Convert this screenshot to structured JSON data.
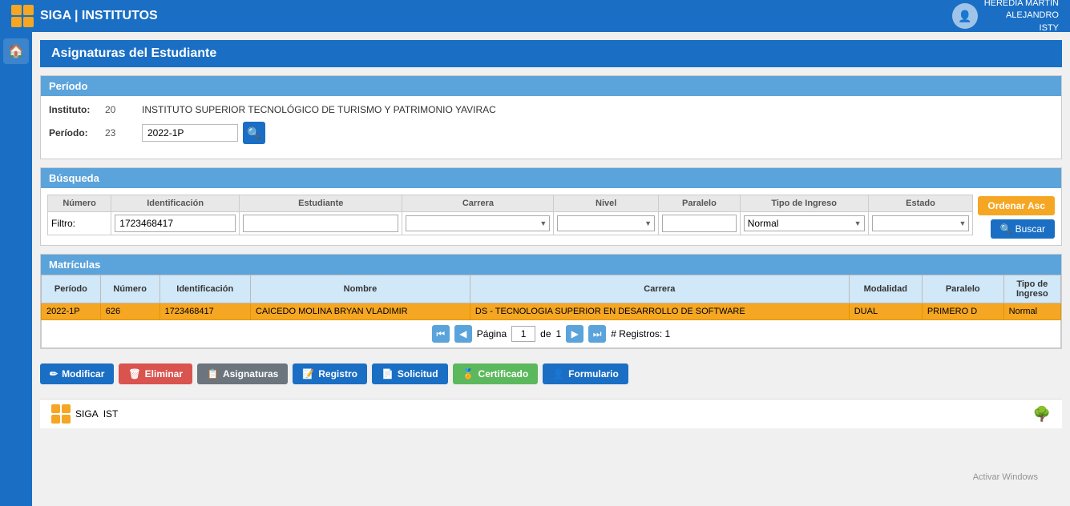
{
  "header": {
    "title": "SIGA | INSTITUTOS",
    "user": {
      "name": "HEREDIA MARTIN",
      "role": "ALEJANDRO",
      "org": "ISTY"
    }
  },
  "page": {
    "title": "Asignaturas del Estudiante"
  },
  "periodo_section": {
    "label": "Período",
    "instituto_label": "Instituto:",
    "instituto_code": "20",
    "instituto_name": "INSTITUTO SUPERIOR TECNOLÓGICO DE TURISMO Y PATRIMONIO YAVIRAC",
    "periodo_label": "Período:",
    "periodo_code": "23",
    "periodo_value": "2022-1P"
  },
  "busqueda_section": {
    "label": "Búsqueda",
    "columns": {
      "numero": "Número",
      "identificacion": "Identificación",
      "estudiante": "Estudiante",
      "carrera": "Carrera",
      "nivel": "Nivel",
      "paralelo": "Paralelo",
      "tipo_ingreso": "Tipo de Ingreso",
      "estado": "Estado"
    },
    "filter_row_label": "Filtro:",
    "filter_numero": "",
    "filter_identificacion": "1723468417",
    "filter_estudiante": "",
    "filter_carrera": "",
    "filter_nivel": "",
    "filter_paralelo": "",
    "filter_tipo_ingreso": "Normal",
    "filter_estado": "",
    "order_btn": "Ordenar Asc",
    "buscar_btn": "Buscar"
  },
  "matriculas_section": {
    "label": "Matrículas",
    "columns": {
      "periodo": "Período",
      "numero": "Número",
      "identificacion": "Identificación",
      "nombre": "Nombre",
      "carrera": "Carrera",
      "modalidad": "Modalidad",
      "paralelo": "Paralelo",
      "tipo_ingreso": "Tipo de Ingreso"
    },
    "rows": [
      {
        "periodo": "2022-1P",
        "numero": "626",
        "identificacion": "1723468417",
        "nombre": "CAICEDO MOLINA BRYAN VLADIMIR",
        "carrera": "DS - TECNOLOGIA SUPERIOR EN DESARROLLO DE SOFTWARE",
        "modalidad": "DUAL",
        "paralelo": "PRIMERO D",
        "tipo_ingreso": "Normal"
      }
    ],
    "pagination": {
      "page_label": "Página",
      "of_label": "de",
      "page_current": "1",
      "page_total": "1",
      "records_label": "# Registros: 1"
    }
  },
  "action_buttons": [
    {
      "id": "modificar",
      "label": "Modificar",
      "icon": "✏"
    },
    {
      "id": "eliminar",
      "label": "Eliminar",
      "icon": "🗑"
    },
    {
      "id": "asignaturas",
      "label": "Asignaturas",
      "icon": "📋"
    },
    {
      "id": "registro",
      "label": "Registro",
      "icon": "📝"
    },
    {
      "id": "solicitud",
      "label": "Solicitud",
      "icon": "📄"
    },
    {
      "id": "certificado",
      "label": "Certificado",
      "icon": "🏅"
    },
    {
      "id": "formulario",
      "label": "Formulario",
      "icon": "👤"
    }
  ],
  "footer": {
    "logo_text": "SIGA",
    "sub_text": "IST",
    "activate_windows": "Activar Windows"
  }
}
